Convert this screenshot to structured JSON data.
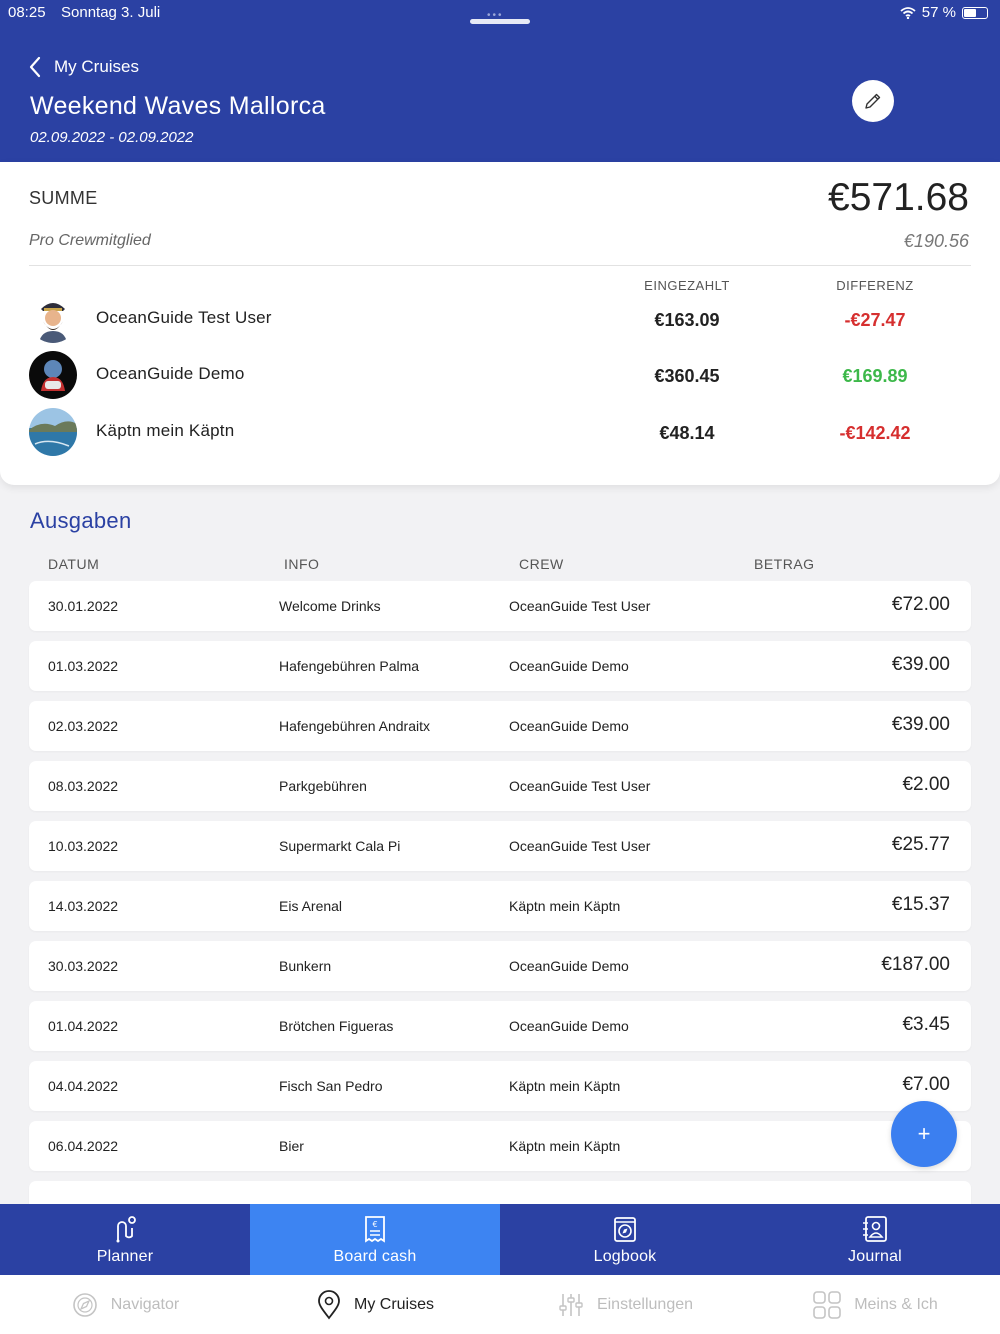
{
  "status_bar": {
    "time": "08:25",
    "date": "Sonntag 3. Juli",
    "battery": "57 %",
    "battery_level": 0.57
  },
  "header": {
    "back_label": "My Cruises",
    "title": "Weekend Waves Mallorca",
    "dates": "02.09.2022 - 02.09.2022",
    "edit_icon": "pencil-icon"
  },
  "summary": {
    "total_label": "SUMME",
    "total_value": "€571.68",
    "per_member_label": "Pro Crewmitglied",
    "per_member_value": "€190.56",
    "col_paid": "EINGEZAHLT",
    "col_diff": "DIFFERENZ",
    "members": [
      {
        "name": "OceanGuide Test User",
        "paid": "€163.09",
        "diff": "-€27.47",
        "diff_color": "#d62f2f"
      },
      {
        "name": "OceanGuide Demo",
        "paid": "€360.45",
        "diff": "€169.89",
        "diff_color": "#3db84a"
      },
      {
        "name": "Käptn mein Käptn",
        "paid": "€48.14",
        "diff": "-€142.42",
        "diff_color": "#d62f2f"
      }
    ]
  },
  "expenses": {
    "title": "Ausgaben",
    "headers": {
      "date": "DATUM",
      "info": "INFO",
      "crew": "CREW",
      "amount": "BETRAG"
    },
    "rows": [
      {
        "date": "30.01.2022",
        "info": "Welcome Drinks",
        "crew": "OceanGuide Test User",
        "amount": "€72.00"
      },
      {
        "date": "01.03.2022",
        "info": "Hafengebühren Palma",
        "crew": "OceanGuide Demo",
        "amount": "€39.00"
      },
      {
        "date": "02.03.2022",
        "info": "Hafengebühren Andraitx",
        "crew": "OceanGuide Demo",
        "amount": "€39.00"
      },
      {
        "date": "08.03.2022",
        "info": "Parkgebühren",
        "crew": "OceanGuide Test User",
        "amount": "€2.00"
      },
      {
        "date": "10.03.2022",
        "info": "Supermarkt Cala Pi",
        "crew": "OceanGuide Test User",
        "amount": "€25.77"
      },
      {
        "date": "14.03.2022",
        "info": "Eis Arenal",
        "crew": "Käptn mein Käptn",
        "amount": "€15.37"
      },
      {
        "date": "30.03.2022",
        "info": "Bunkern",
        "crew": "OceanGuide Demo",
        "amount": "€187.00"
      },
      {
        "date": "01.04.2022",
        "info": "Brötchen Figueras",
        "crew": "OceanGuide Demo",
        "amount": "€3.45"
      },
      {
        "date": "04.04.2022",
        "info": "Fisch San Pedro",
        "crew": "Käptn mein Käptn",
        "amount": "€7.00"
      },
      {
        "date": "06.04.2022",
        "info": "Bier",
        "crew": "Käptn mein Käptn",
        "amount": ""
      }
    ],
    "fab_label": "+"
  },
  "tabs": [
    {
      "label": "Planner",
      "icon": "route-icon",
      "active": false
    },
    {
      "label": "Board cash",
      "icon": "receipt-euro-icon",
      "active": true
    },
    {
      "label": "Logbook",
      "icon": "logbook-compass-icon",
      "active": false
    },
    {
      "label": "Journal",
      "icon": "contacts-book-icon",
      "active": false
    }
  ],
  "bottom_nav": [
    {
      "label": "Navigator",
      "icon": "compass-icon",
      "active": false
    },
    {
      "label": "My Cruises",
      "icon": "map-pin-icon",
      "active": true
    },
    {
      "label": "Einstellungen",
      "icon": "sliders-icon",
      "active": false
    },
    {
      "label": "Meins & Ich",
      "icon": "grid-icon",
      "active": false
    }
  ],
  "colors": {
    "primary": "#2b41a3",
    "active_tab": "#3d84f2",
    "fab": "#3b7ff0",
    "negative": "#d62f2f",
    "positive": "#3db84a"
  }
}
